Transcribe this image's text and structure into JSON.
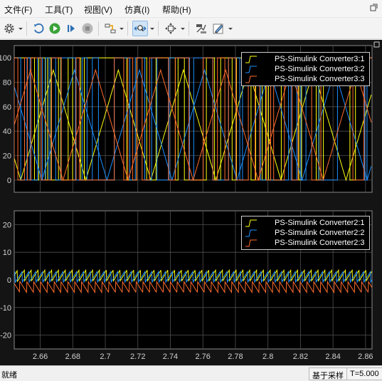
{
  "menu": [
    {
      "name": "menu-file",
      "label": "文件(F)"
    },
    {
      "name": "menu-tools",
      "label": "工具(T)"
    },
    {
      "name": "menu-view",
      "label": "视图(V)"
    },
    {
      "name": "menu-simulation",
      "label": "仿真(I)"
    },
    {
      "name": "menu-help",
      "label": "帮助(H)"
    }
  ],
  "toolbar": {
    "icons": [
      "gear-icon",
      "step-back-icon",
      "run-icon",
      "step-forward-icon",
      "stop-icon",
      "highlight-icon",
      "zoom-x-icon",
      "fit-icon",
      "write-data-icon",
      "style-icon"
    ],
    "active": "zoom-x-icon"
  },
  "colors": {
    "yellow": "#ffff0d",
    "blue": "#1e90ff",
    "orange": "#ff6d2e",
    "grid": "#505050",
    "axes_bg": "#000000",
    "tick_text": "#d0d0d0"
  },
  "chart_data": [
    {
      "type": "line",
      "ylim": [
        -10,
        110
      ],
      "xlim": [
        2.644,
        2.864
      ],
      "yticks": [
        0,
        20,
        40,
        60,
        80,
        100
      ],
      "grid": true,
      "legend_position": "top-right",
      "series": [
        {
          "name": "PS-Simulink Converter3:1",
          "color": "yellow",
          "triangle": {
            "period": 0.04,
            "phase": 2.648,
            "peak": 90
          }
        },
        {
          "name": "PS-Simulink Converter3:2",
          "color": "blue",
          "triangle": {
            "period": 0.04,
            "phase": 2.661,
            "peak": 90
          }
        },
        {
          "name": "PS-Simulink Converter3:3",
          "color": "orange",
          "triangle": {
            "period": 0.04,
            "phase": 2.674,
            "peak": 90
          }
        }
      ]
    },
    {
      "type": "line",
      "ylim": [
        -25,
        25
      ],
      "xlim": [
        2.644,
        2.864
      ],
      "yticks": [
        -20,
        -10,
        0,
        10,
        20
      ],
      "xticks": [
        2.66,
        2.68,
        2.7,
        2.72,
        2.74,
        2.76,
        2.78,
        2.8,
        2.82,
        2.84,
        2.86
      ],
      "grid": true,
      "legend_position": "top-right",
      "series": [
        {
          "name": "PS-Simulink Converter2:1",
          "color": "yellow",
          "baseline": 1.5,
          "amplitude": 4
        },
        {
          "name": "PS-Simulink Converter2:2",
          "color": "blue",
          "baseline": 1.0,
          "amplitude": 4
        },
        {
          "name": "PS-Simulink Converter2:3",
          "color": "orange",
          "baseline": -2.5,
          "amplitude": 4
        }
      ]
    }
  ],
  "status": {
    "text": "就绪",
    "mode": "基于采样",
    "time": "T=5.000"
  }
}
